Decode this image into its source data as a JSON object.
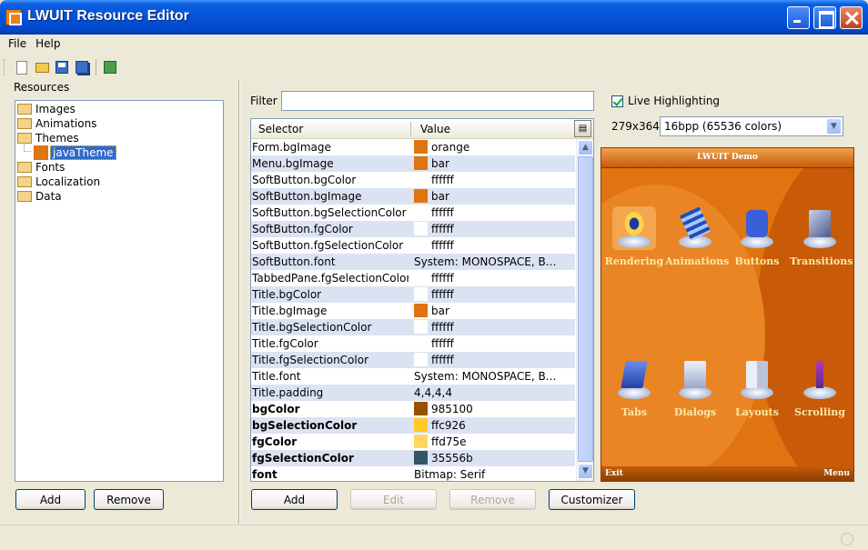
{
  "window": {
    "title": "LWUIT Resource Editor"
  },
  "menu": [
    "File",
    "Help"
  ],
  "toolbar": {
    "icons": [
      "new-file-icon",
      "open-folder-icon",
      "save-icon",
      "save-as-icon",
      "exit-icon"
    ]
  },
  "resources": {
    "label": "Resources",
    "tree": [
      {
        "label": "Images",
        "icon": "folder-icon"
      },
      {
        "label": "Animations",
        "icon": "folder-icon"
      },
      {
        "label": "Themes",
        "icon": "folder-icon"
      },
      {
        "label": "javaTheme",
        "icon": "theme-icon",
        "selected": true
      },
      {
        "label": "Fonts",
        "icon": "folder-icon"
      },
      {
        "label": "Localization",
        "icon": "folder-icon"
      },
      {
        "label": "Data",
        "icon": "folder-icon"
      }
    ],
    "add_label": "Add",
    "remove_label": "Remove"
  },
  "filter": {
    "label": "Filter",
    "value": ""
  },
  "table": {
    "headers": {
      "selector": "Selector",
      "value": "Value"
    },
    "rows": [
      {
        "selector": "Form.bgImage",
        "value": "orange",
        "swatch": "#e07411",
        "bold": false
      },
      {
        "selector": "Menu.bgImage",
        "value": "bar",
        "swatch": "#e07411",
        "bold": false
      },
      {
        "selector": "SoftButton.bgColor",
        "value": "ffffff",
        "swatch": "#ffffff",
        "bold": false
      },
      {
        "selector": "SoftButton.bgImage",
        "value": "bar",
        "swatch": "#e07411",
        "bold": false
      },
      {
        "selector": "SoftButton.bgSelectionColor",
        "value": "ffffff",
        "swatch": "#ffffff",
        "bold": false
      },
      {
        "selector": "SoftButton.fgColor",
        "value": "ffffff",
        "swatch": "#ffffff",
        "bold": false
      },
      {
        "selector": "SoftButton.fgSelectionColor",
        "value": "ffffff",
        "swatch": "#ffffff",
        "bold": false
      },
      {
        "selector": "SoftButton.font",
        "value": "System: MONOSPACE, BOLD...",
        "swatch": null,
        "bold": false
      },
      {
        "selector": "TabbedPane.fgSelectionColor",
        "value": "ffffff",
        "swatch": "#ffffff",
        "bold": false
      },
      {
        "selector": "Title.bgColor",
        "value": "ffffff",
        "swatch": "#ffffff",
        "bold": false
      },
      {
        "selector": "Title.bgImage",
        "value": "bar",
        "swatch": "#e07411",
        "bold": false
      },
      {
        "selector": "Title.bgSelectionColor",
        "value": "ffffff",
        "swatch": "#ffffff",
        "bold": false
      },
      {
        "selector": "Title.fgColor",
        "value": "ffffff",
        "swatch": "#ffffff",
        "bold": false
      },
      {
        "selector": "Title.fgSelectionColor",
        "value": "ffffff",
        "swatch": "#ffffff",
        "bold": false
      },
      {
        "selector": "Title.font",
        "value": "System: MONOSPACE, BOLD...",
        "swatch": null,
        "bold": false
      },
      {
        "selector": "Title.padding",
        "value": "4,4,4,4",
        "swatch": null,
        "bold": false
      },
      {
        "selector": "bgColor",
        "value": "985100",
        "swatch": "#985100",
        "bold": true
      },
      {
        "selector": "bgSelectionColor",
        "value": "ffc926",
        "swatch": "#ffc926",
        "bold": true
      },
      {
        "selector": "fgColor",
        "value": "ffd75e",
        "swatch": "#ffd75e",
        "bold": true
      },
      {
        "selector": "fgSelectionColor",
        "value": "35556b",
        "swatch": "#35556b",
        "bold": true
      },
      {
        "selector": "font",
        "value": "Bitmap: Serif",
        "swatch": null,
        "bold": true
      }
    ],
    "add_label": "Add",
    "edit_label": "Edit",
    "remove_label": "Remove",
    "customizer_label": "Customizer"
  },
  "preview": {
    "live_label": "Live Highlighting",
    "live_checked": true,
    "resolution_label": "279x364",
    "color_depth": "16bpp (65536 colors)",
    "title": "LWUIT Demo",
    "items": [
      {
        "label": "Rendering",
        "shape": "eye",
        "selected": true
      },
      {
        "label": "Animations",
        "shape": "film",
        "selected": false
      },
      {
        "label": "Buttons",
        "shape": "btns",
        "selected": false
      },
      {
        "label": "Transitions",
        "shape": "trans",
        "selected": false
      },
      {
        "label": "Tabs",
        "shape": "tabs",
        "selected": false
      },
      {
        "label": "Dialogs",
        "shape": "dlg",
        "selected": false
      },
      {
        "label": "Layouts",
        "shape": "lay",
        "selected": false
      },
      {
        "label": "Scrolling",
        "shape": "scr",
        "selected": false
      }
    ],
    "left_soft": "Exit",
    "right_soft": "Menu"
  },
  "colors": {
    "accent": "#e07411",
    "selection": "#316ac5",
    "row_alt": "#dbe3f3"
  }
}
